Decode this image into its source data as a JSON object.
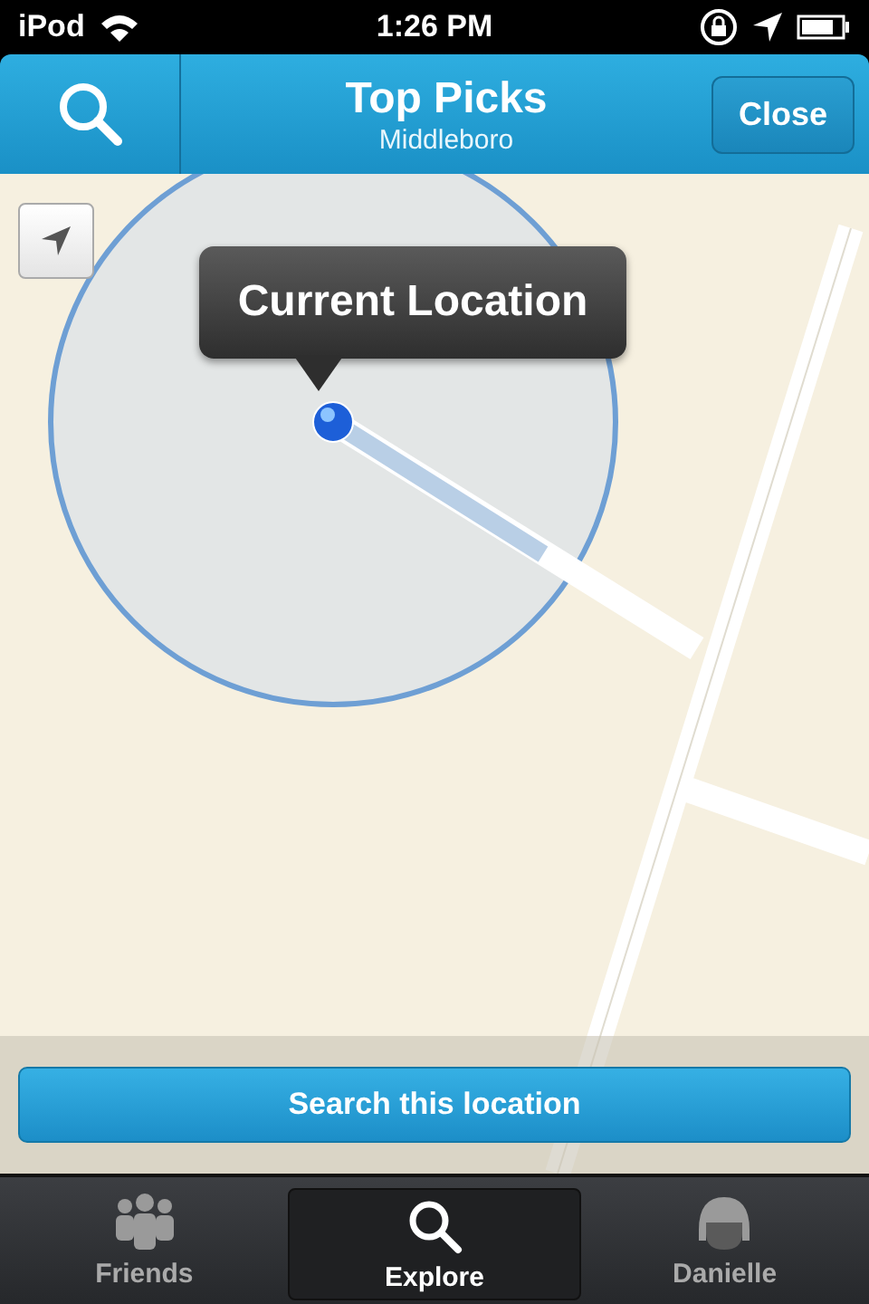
{
  "status_bar": {
    "carrier": "iPod",
    "time": "1:26 PM"
  },
  "nav_bar": {
    "title": "Top Picks",
    "subtitle": "Middleboro",
    "close_button": "Close"
  },
  "map": {
    "kind": "picture",
    "callout": "Current Location"
  },
  "search_button": "Search this location",
  "tabs": [
    {
      "label": "Friends",
      "kind": "people",
      "selected": false
    },
    {
      "label": "Explore",
      "kind": "search",
      "selected": true
    },
    {
      "label": "Danielle",
      "kind": "avatar",
      "selected": false
    }
  ]
}
